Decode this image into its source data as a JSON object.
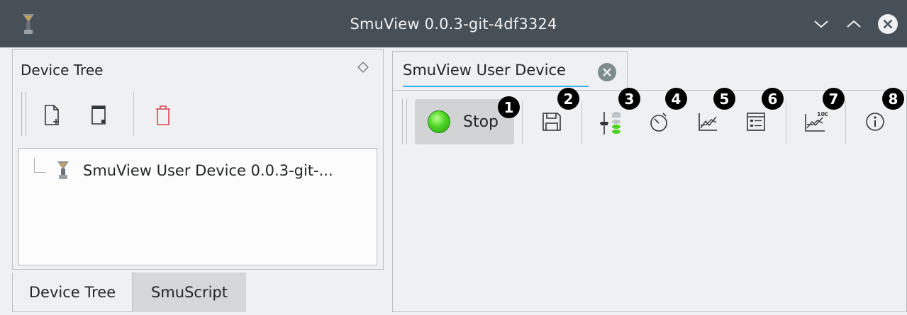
{
  "window": {
    "title": "SmuView 0.0.3-git-4df3324",
    "app_icon": "smuview-logo-icon",
    "controls": [
      "chevron-down-icon",
      "chevron-up-icon",
      "close-circle-icon"
    ]
  },
  "left_dock": {
    "title": "Device Tree",
    "toolbar": [
      {
        "name": "add-device-button",
        "icon": "new-document-icon"
      },
      {
        "name": "add-user-device-button",
        "icon": "new-user-device-icon"
      },
      {
        "name": "delete-button",
        "icon": "trash-icon"
      }
    ],
    "tree": {
      "items": [
        {
          "label": "SmuView User Device 0.0.3-git-...",
          "icon": "smuview-logo-icon"
        }
      ]
    },
    "tabs": [
      {
        "label": "Device Tree",
        "active": true
      },
      {
        "label": "SmuScript",
        "active": false
      }
    ]
  },
  "main": {
    "tab": {
      "label": "SmuView User Device",
      "close_icon": "close-circle-icon"
    },
    "toolbar": {
      "stop_label": "Stop",
      "tools": [
        {
          "icon": "save-icon",
          "badge": "2"
        },
        {
          "icon": "add-control-icon",
          "badge": "3"
        },
        {
          "icon": "add-time-plot-icon",
          "badge": "4"
        },
        {
          "icon": "add-xy-plot-icon",
          "badge": "5"
        },
        {
          "icon": "add-data-table-icon",
          "badge": "6"
        },
        {
          "icon": "add-math-channel-icon",
          "badge": "7"
        },
        {
          "icon": "info-icon",
          "badge": "8"
        }
      ],
      "stop_badge": "1"
    },
    "colors": {
      "accent": "#3daee9",
      "led": "#4cd425",
      "delete": "#da4453"
    }
  }
}
